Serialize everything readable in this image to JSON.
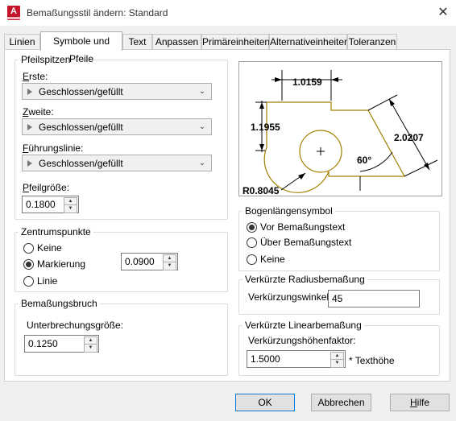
{
  "window": {
    "title": "Bemaßungsstil ändern: Standard",
    "app_icon_letter": "A"
  },
  "tabs": [
    {
      "label": "Linien"
    },
    {
      "label": "Symbole und Pfeile"
    },
    {
      "label": "Text"
    },
    {
      "label": "Anpassen"
    },
    {
      "label": "Primäreinheiten"
    },
    {
      "label": "Alternativeinheiten"
    },
    {
      "label": "Toleranzen"
    }
  ],
  "arrowheads": {
    "group_label": "Pfeilspitzen",
    "first_label": "Erste:",
    "first_value": "Geschlossen/gefüllt",
    "second_label": "Zweite:",
    "second_value": "Geschlossen/gefüllt",
    "leader_label": "Führungslinie:",
    "leader_value": "Geschlossen/gefüllt",
    "size_label": "Pfeilgröße:",
    "size_value": "0.1800"
  },
  "center_marks": {
    "group_label": "Zentrumspunkte",
    "options": [
      "Keine",
      "Markierung",
      "Linie"
    ],
    "selected": "Markierung",
    "size_value": "0.0900"
  },
  "dim_break": {
    "group_label": "Bemaßungsbruch",
    "size_label": "Unterbrechungsgröße:",
    "size_value": "0.1250"
  },
  "preview": {
    "dim_top": "1.0159",
    "dim_left": "1.1955",
    "dim_right": "2.0207",
    "angle": "60°",
    "radius": "R0.8045"
  },
  "arc_length": {
    "group_label": "Bogenlängensymbol",
    "options": [
      "Vor Bemaßungstext",
      "Über Bemaßungstext",
      "Keine"
    ],
    "selected": "Vor Bemaßungstext"
  },
  "radius_jog": {
    "group_label": "Verkürzte Radiusbemaßung",
    "angle_label": "Verkürzungswinkel:",
    "angle_value": "45"
  },
  "linear_jog": {
    "group_label": "Verkürzte Linearbemaßung",
    "factor_label": "Verkürzungshöhenfaktor:",
    "factor_value": "1.5000",
    "factor_suffix": "* Texthöhe"
  },
  "buttons": {
    "ok": "OK",
    "cancel": "Abbrechen",
    "help": "Hilfe"
  },
  "colors": {
    "accent": "#0078d7",
    "preview_geometry": "#a08000"
  }
}
